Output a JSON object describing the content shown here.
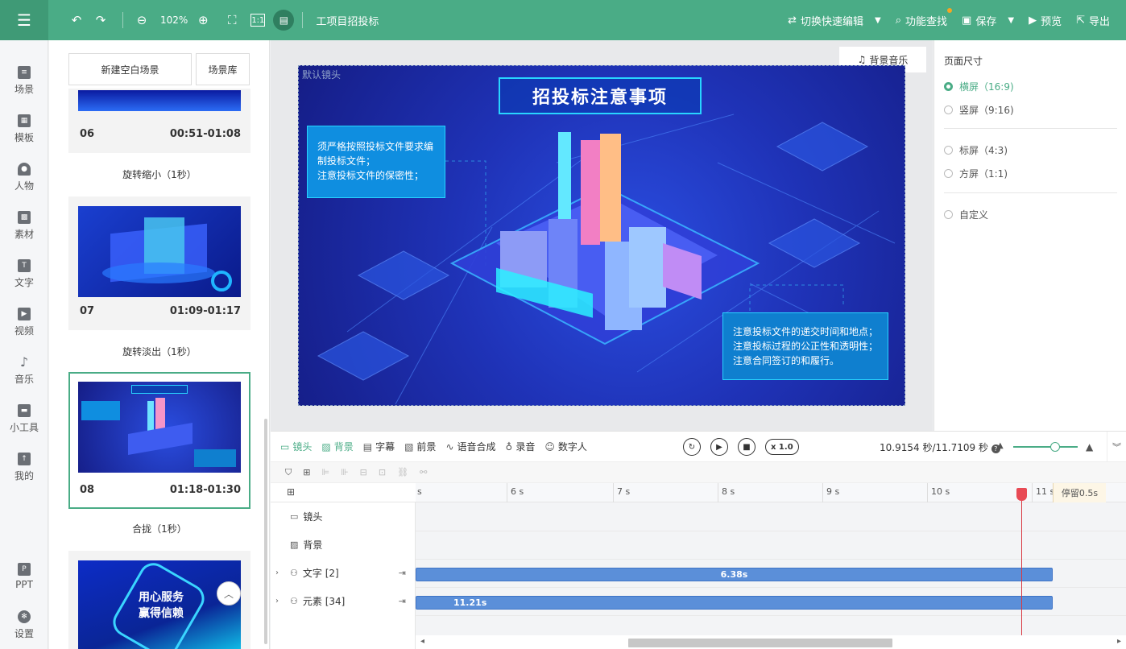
{
  "toolbar": {
    "menu_icon": "hamburger-icon",
    "zoom": "102%",
    "doc_title": "工项目招投标",
    "quick_edit": "切换快速编辑",
    "search": "功能查找",
    "save": "保存",
    "preview": "预览",
    "export": "导出",
    "accent_color": "#4aac86"
  },
  "nav": [
    {
      "label": "场景",
      "icon": "scene-icon"
    },
    {
      "label": "模板",
      "icon": "template-icon"
    },
    {
      "label": "人物",
      "icon": "person-icon"
    },
    {
      "label": "素材",
      "icon": "material-icon"
    },
    {
      "label": "文字",
      "icon": "text-icon"
    },
    {
      "label": "视频",
      "icon": "video-icon"
    },
    {
      "label": "音乐",
      "icon": "music-icon"
    },
    {
      "label": "小工具",
      "icon": "toolbox-icon"
    },
    {
      "label": "我的",
      "icon": "upload-icon"
    },
    {
      "label": "PPT",
      "icon": "ppt-icon"
    },
    {
      "label": "设置",
      "icon": "gear-icon"
    }
  ],
  "scenes": {
    "new_blank": "新建空白场景",
    "library": "场景库",
    "items": [
      {
        "num": "06",
        "time": "00:51-01:08",
        "transition": "旋转缩小（1秒）"
      },
      {
        "num": "07",
        "time": "01:09-01:17",
        "transition": "旋转淡出（1秒）"
      },
      {
        "num": "08",
        "time": "01:18-01:30",
        "transition": "合拢（1秒）"
      }
    ],
    "next_thumb_text": [
      "用心服务",
      "赢得信赖"
    ]
  },
  "canvas": {
    "bgm": "背景音乐",
    "default_shot": "默认镜头",
    "title": "招投标注意事项",
    "box1": [
      "须严格按照投标文件要求编",
      "制投标文件；",
      "注意投标文件的保密性；"
    ],
    "box2": [
      "注意投标文件的递交时间和地点；",
      "注意投标过程的公正性和透明性；",
      "注意合同签订的和履行。"
    ]
  },
  "props": {
    "title": "页面尺寸",
    "options": [
      {
        "label": "横屏（16:9)",
        "selected": true
      },
      {
        "label": "竖屏（9:16)",
        "selected": false
      },
      {
        "label": "标屏（4:3)",
        "selected": false
      },
      {
        "label": "方屏（1:1)",
        "selected": false
      },
      {
        "label": "自定义",
        "selected": false
      }
    ]
  },
  "timeline": {
    "tabs": [
      {
        "label": "镜头",
        "icon": "camera-icon",
        "active": true
      },
      {
        "label": "背景",
        "icon": "background-icon",
        "active": true
      },
      {
        "label": "字幕",
        "icon": "subtitle-icon",
        "active": false
      },
      {
        "label": "前景",
        "icon": "foreground-icon",
        "active": false
      },
      {
        "label": "语音合成",
        "icon": "waveform-icon",
        "active": false
      },
      {
        "label": "录音",
        "icon": "mic-icon",
        "active": false
      },
      {
        "label": "数字人",
        "icon": "digital-human-icon",
        "active": false
      }
    ],
    "speed": "x 1.0",
    "time": "10.9154 秒/11.7109 秒",
    "ruler": [
      "s",
      "6 s",
      "7 s",
      "8 s",
      "9 s",
      "10 s",
      "11 s"
    ],
    "stay": "停留0.5s",
    "tracks": [
      {
        "label": "镜头"
      },
      {
        "label": "背景"
      },
      {
        "label": "文字 [2]",
        "bar": "6.38s"
      },
      {
        "label": "元素 [34]",
        "bar": "11.21s"
      }
    ]
  }
}
